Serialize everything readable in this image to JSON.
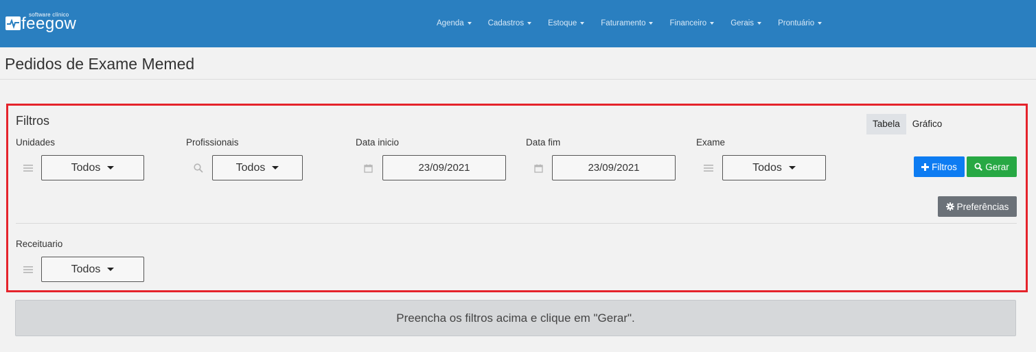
{
  "logo": {
    "tagline": "software clínico",
    "wordmark": "feegow"
  },
  "nav": {
    "items": [
      {
        "label": "Agenda"
      },
      {
        "label": "Cadastros"
      },
      {
        "label": "Estoque"
      },
      {
        "label": "Faturamento"
      },
      {
        "label": "Financeiro"
      },
      {
        "label": "Gerais"
      },
      {
        "label": "Prontuário"
      }
    ]
  },
  "page": {
    "title": "Pedidos de Exame Memed"
  },
  "filters": {
    "heading": "Filtros",
    "view_toggle": {
      "table": "Tabela",
      "chart": "Gráfico",
      "active": "Tabela"
    },
    "units": {
      "label": "Unidades",
      "value": "Todos",
      "icon": "list-icon"
    },
    "professionals": {
      "label": "Profissionais",
      "value": "Todos",
      "icon": "search-icon"
    },
    "start_date": {
      "label": "Data inicio",
      "value": "23/09/2021",
      "icon": "calendar-icon"
    },
    "end_date": {
      "label": "Data fim",
      "value": "23/09/2021",
      "icon": "calendar-icon"
    },
    "exam": {
      "label": "Exame",
      "value": "Todos",
      "icon": "list-icon"
    },
    "prescription": {
      "label": "Receituario",
      "value": "Todos",
      "icon": "list-icon"
    },
    "buttons": {
      "filters": "Filtros",
      "generate": "Gerar",
      "preferences": "Preferências"
    }
  },
  "message": "Preencha os filtros acima e clique em \"Gerar\".",
  "colors": {
    "navbar": "#2a7fc0",
    "highlight_border": "#e5232b",
    "filters_button": "#0d7cf2",
    "generate_button": "#27a844",
    "preferences_button": "#6b7178"
  }
}
